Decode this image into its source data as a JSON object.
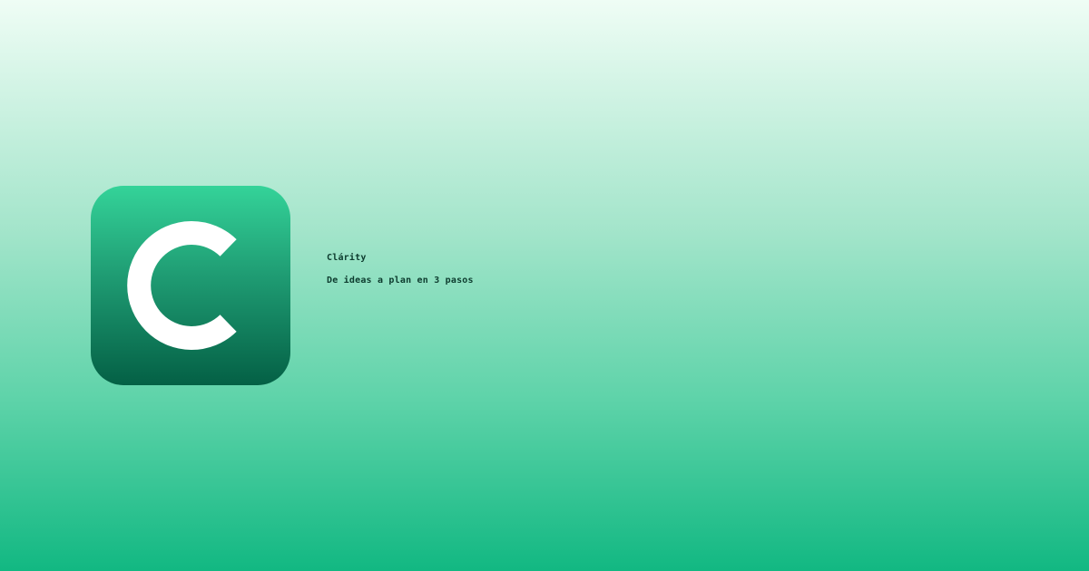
{
  "brand": {
    "app_name": "Clárity",
    "tagline": "De ideas a plan en 3 pasos",
    "logo_icon": "letter-c-icon"
  },
  "colors": {
    "accent": "#10b981",
    "logo_top": "#34d399",
    "logo_bottom": "#046045",
    "text": "#0d3b2e"
  }
}
